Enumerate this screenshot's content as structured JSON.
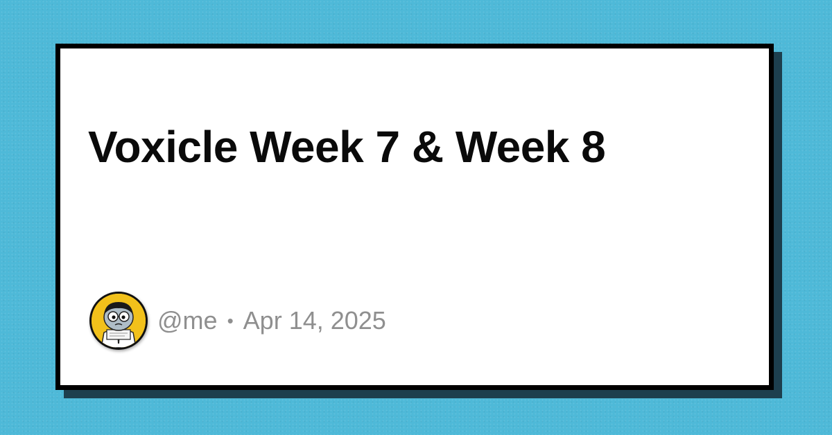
{
  "card": {
    "title": "Voxicle Week 7 & Week 8"
  },
  "author": {
    "handle": "@me",
    "separator": "•",
    "date": "Apr 14, 2025",
    "avatar_icon": "cartoon-character-avatar"
  },
  "colors": {
    "background": "#4eb9d8",
    "card": "#ffffff",
    "card_border": "#000000",
    "card_shadow": "#1d3f4e",
    "title": "#0a0a0a",
    "meta_text": "#8f8f8f",
    "avatar_background": "#f2c11b"
  }
}
